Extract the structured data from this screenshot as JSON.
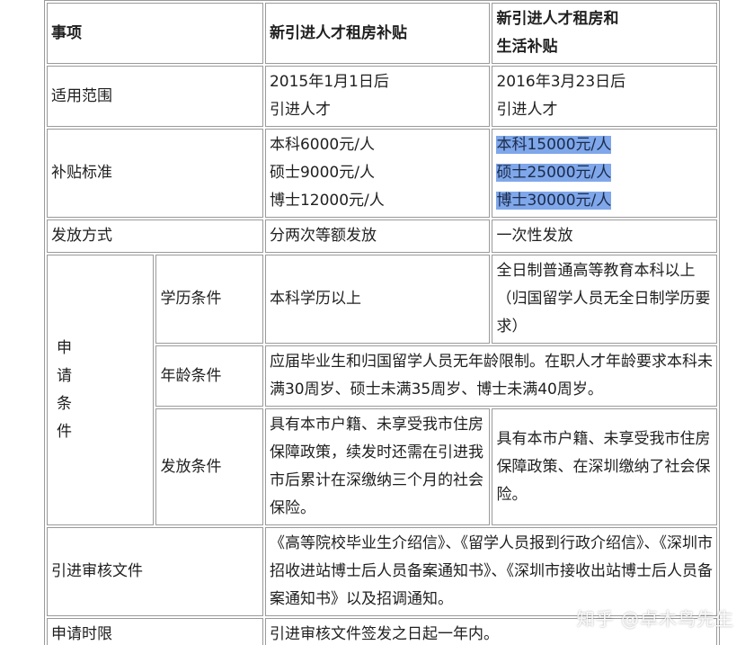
{
  "table": {
    "header": {
      "item": "事项",
      "col_a": "新引进人才租房补贴",
      "col_b_line1": "新引进人才租房和",
      "col_b_line2": "生活补贴"
    },
    "scope": {
      "label": "适用范围",
      "a_line1": "2015年1月1日后",
      "a_line2": "引进人才",
      "b_line1": "2016年3月23日后",
      "b_line2": "引进人才"
    },
    "standard": {
      "label": "补贴标准",
      "a_line1": "本科6000元/人",
      "a_line2": "硕士9000元/人",
      "a_line3": "博士12000元/人",
      "b_line1": "本科15000元/人",
      "b_line2": "硕士25000元/人",
      "b_line3": "博士30000元/人"
    },
    "method": {
      "label": "发放方式",
      "a": "分两次等额发放",
      "b": "一次性发放"
    },
    "conditions": {
      "group_chars": [
        "申",
        "请",
        "条",
        "件"
      ],
      "education": {
        "label": "学历条件",
        "a": "本科学历以上",
        "b": "全日制普通高等教育本科以上（归国留学人员无全日制学历要求）"
      },
      "age": {
        "label": "年龄条件",
        "text": "应届毕业生和归国留学人员无年龄限制。在职人才年龄要求本科未满30周岁、硕士未满35周岁、博士未满40周岁。"
      },
      "payout": {
        "label": "发放条件",
        "a": "具有本市户籍、未享受我市住房保障政策，续发时还需在引进我市后累计在深缴纳三个月的社会保险。",
        "b": "具有本市户籍、未享受我市住房保障政策、在深圳缴纳了社会保险。"
      }
    },
    "documents": {
      "label": "引进审核文件",
      "text": "《高等院校毕业生介绍信》、《留学人员报到行政介绍信》、《深圳市招收进站博士后人员备案通知书》、《深圳市接收出站博士后人员备案通知书》以及招调通知。"
    },
    "deadline": {
      "label": "申请时限",
      "text": "引进审核文件签发之日起一年内。"
    }
  },
  "watermark": "知乎 @卓木鸟先生",
  "colors": {
    "highlight": "#7fa7ea",
    "border": "#9a9a9a"
  }
}
